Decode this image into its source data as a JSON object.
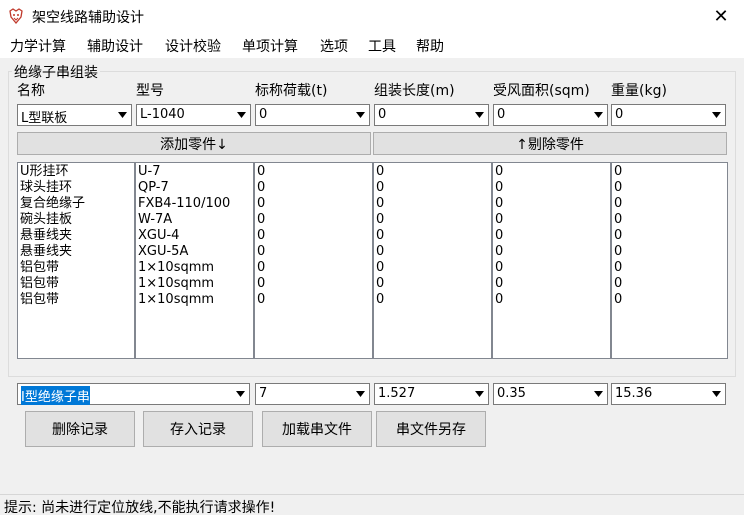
{
  "window": {
    "title": "架空线路辅助设计",
    "close_glyph": "✕"
  },
  "menu": [
    "力学计算",
    "辅助设计",
    "设计校验",
    "单项计算",
    "选项",
    "工具",
    "帮助"
  ],
  "group": {
    "title": "绝缘子串组装",
    "columns": [
      "名称",
      "型号",
      "标称荷载(t)",
      "组装长度(m)",
      "受风面积(sqm)",
      "重量(kg)"
    ],
    "selectors": [
      "L型联板",
      "L-1040",
      "0",
      "0",
      "0",
      "0"
    ],
    "add_button": "添加零件↓",
    "remove_button": "↑剔除零件",
    "lists": {
      "names": [
        "U形挂环",
        "球头挂环",
        "复合绝缘子",
        "碗头挂板",
        "悬垂线夹",
        "悬垂线夹",
        "铝包带",
        "铝包带",
        "铝包带"
      ],
      "models": [
        "U-7",
        "QP-7",
        "FXB4-110/100",
        "W-7A",
        "XGU-4",
        "XGU-5A",
        "1×10sqmm",
        "1×10sqmm",
        "1×10sqmm"
      ],
      "loads": [
        "0",
        "0",
        "0",
        "0",
        "0",
        "0",
        "0",
        "0",
        "0"
      ],
      "lengths": [
        "0",
        "0",
        "0",
        "0",
        "0",
        "0",
        "0",
        "0",
        "0"
      ],
      "areas": [
        "0",
        "0",
        "0",
        "0",
        "0",
        "0",
        "0",
        "0",
        "0"
      ],
      "weights": [
        "0",
        "0",
        "0",
        "0",
        "0",
        "0",
        "0",
        "0",
        "0"
      ]
    }
  },
  "record": {
    "name": "I型绝缘子串",
    "load": "7",
    "length": "1.527",
    "area": "0.35",
    "weight": "15.36"
  },
  "buttons": [
    "删除记录",
    "存入记录",
    "加载串文件",
    "串文件另存"
  ],
  "status": "提示: 尚未进行定位放线,不能执行请求操作!",
  "colors": {
    "accent": "#0078d7",
    "button": "#e1e1e1",
    "background": "#f0f0f0"
  }
}
